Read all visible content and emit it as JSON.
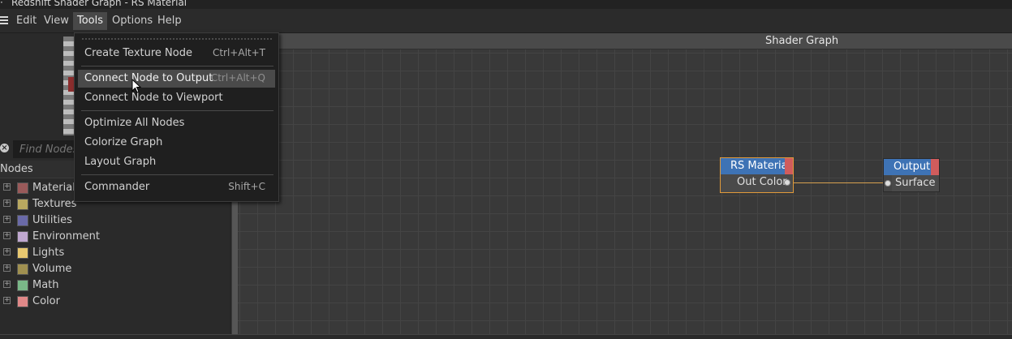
{
  "window": {
    "title": "Redshift Shader Graph - RS Material"
  },
  "menubar": {
    "items": [
      {
        "label": "Edit"
      },
      {
        "label": "View"
      },
      {
        "label": "Tools",
        "active": true
      },
      {
        "label": "Options"
      },
      {
        "label": "Help"
      }
    ]
  },
  "dropdown": {
    "items": [
      {
        "label": "Create Texture Node",
        "shortcut": "Ctrl+Alt+T"
      },
      {
        "label": "Connect Node to Output",
        "shortcut": "Ctrl+Alt+Q",
        "hovered": true
      },
      {
        "label": "Connect Node to Viewport",
        "shortcut": ""
      },
      {
        "label": "Optimize All Nodes",
        "shortcut": ""
      },
      {
        "label": "Colorize Graph",
        "shortcut": ""
      },
      {
        "label": "Layout Graph",
        "shortcut": ""
      },
      {
        "label": "Commander",
        "shortcut": "Shift+C"
      }
    ]
  },
  "search": {
    "placeholder": "Find Nodes..."
  },
  "nodes_panel": {
    "header": "Nodes",
    "categories": [
      {
        "label": "Materials",
        "color": "#9a5a5a"
      },
      {
        "label": "Textures",
        "color": "#b8a860"
      },
      {
        "label": "Utilities",
        "color": "#6a6aa8"
      },
      {
        "label": "Environment",
        "color": "#c0a8d0"
      },
      {
        "label": "Lights",
        "color": "#e8c870"
      },
      {
        "label": "Volume",
        "color": "#a09050"
      },
      {
        "label": "Math",
        "color": "#7ab888"
      },
      {
        "label": "Color",
        "color": "#e08888"
      }
    ]
  },
  "graph": {
    "header": "Shader Graph",
    "nodes": [
      {
        "title": "RS Material",
        "port": "Out Color",
        "selected": true
      },
      {
        "title": "Output",
        "port": "Surface",
        "selected": false
      }
    ]
  },
  "colors": {
    "node_title": "#3e73b5",
    "node_tab": "#d05c5c",
    "selection": "#e09a3a",
    "wire": "#d7a050"
  }
}
